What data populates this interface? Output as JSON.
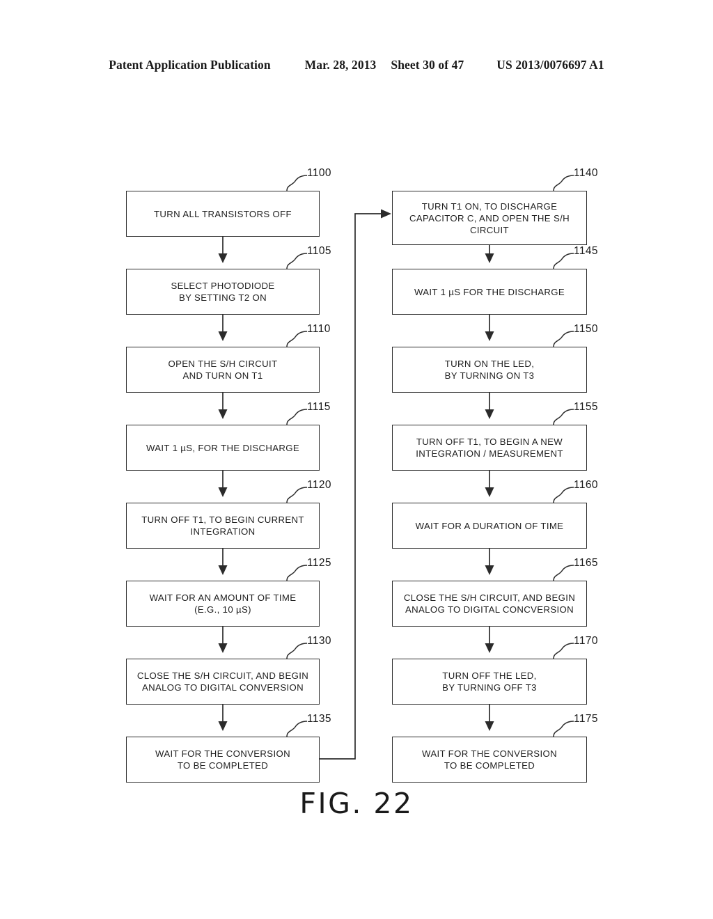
{
  "header": {
    "publication": "Patent Application Publication",
    "date": "Mar. 28, 2013",
    "sheet": "Sheet 30 of 47",
    "patent_number": "US 2013/0076697 A1"
  },
  "figure": {
    "caption": "FIG. 22"
  },
  "flowchart": {
    "left_column": [
      {
        "ref": "1100",
        "text": "TURN ALL TRANSISTORS OFF"
      },
      {
        "ref": "1105",
        "text": "SELECT PHOTODIODE\nBY SETTING T2 ON"
      },
      {
        "ref": "1110",
        "text": "OPEN THE S/H CIRCUIT\nAND TURN ON T1"
      },
      {
        "ref": "1115",
        "text": "WAIT 1 µS, FOR THE DISCHARGE"
      },
      {
        "ref": "1120",
        "text": "TURN OFF T1, TO BEGIN CURRENT\nINTEGRATION"
      },
      {
        "ref": "1125",
        "text": "WAIT FOR AN AMOUNT OF TIME\n(E.G., 10 µS)"
      },
      {
        "ref": "1130",
        "text": "CLOSE THE S/H CIRCUIT, AND BEGIN\nANALOG TO DIGITAL CONVERSION"
      },
      {
        "ref": "1135",
        "text": "WAIT FOR THE CONVERSION\nTO BE COMPLETED"
      }
    ],
    "right_column": [
      {
        "ref": "1140",
        "text": "TURN T1 ON, TO DISCHARGE\nCAPACITOR C, AND OPEN THE S/H\nCIRCUIT"
      },
      {
        "ref": "1145",
        "text": "WAIT 1 µS FOR THE DISCHARGE"
      },
      {
        "ref": "1150",
        "text": "TURN ON THE LED,\nBY TURNING ON T3"
      },
      {
        "ref": "1155",
        "text": "TURN OFF T1, TO BEGIN A NEW\nINTEGRATION / MEASUREMENT"
      },
      {
        "ref": "1160",
        "text": "WAIT FOR A DURATION OF TIME"
      },
      {
        "ref": "1165",
        "text": "CLOSE THE S/H CIRCUIT, AND BEGIN\nANALOG TO DIGITAL CONCVERSION"
      },
      {
        "ref": "1170",
        "text": "TURN OFF THE LED,\nBY TURNING OFF T3"
      },
      {
        "ref": "1175",
        "text": "WAIT FOR THE CONVERSION\nTO BE COMPLETED"
      }
    ]
  }
}
